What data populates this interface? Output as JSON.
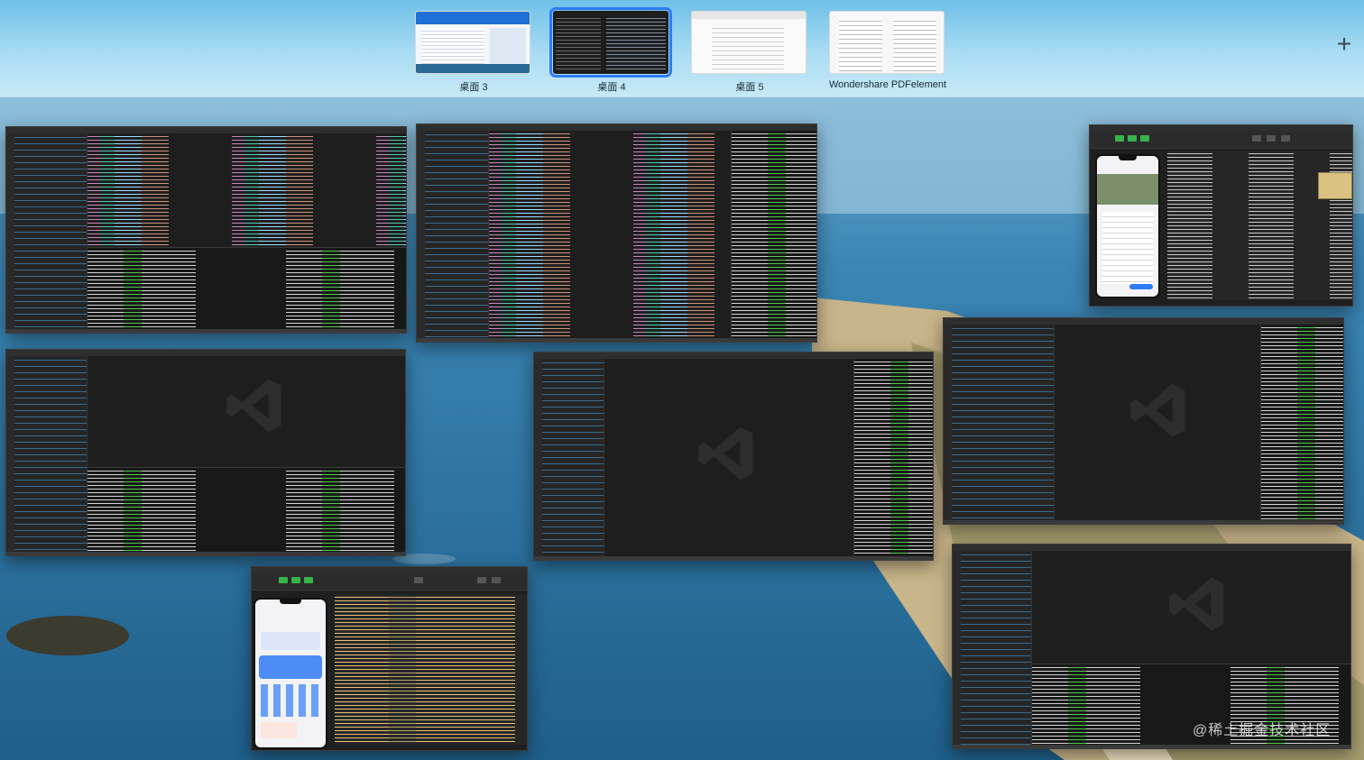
{
  "spaces_bar": {
    "spaces": [
      {
        "label": "桌面 3",
        "active": false
      },
      {
        "label": "桌面 4",
        "active": true
      },
      {
        "label": "桌面 5",
        "active": false
      },
      {
        "label": "Wondershare PDFelement",
        "active": false
      }
    ],
    "add_button": "+"
  },
  "watermark": "@稀土掘金技术社区",
  "colors": {
    "accent": "#2d7cf6",
    "vscode_bg": "#1e1e1e",
    "devtools_green": "#37b34a",
    "ocean": "#2b6a92",
    "sand": "#e6d3aa"
  },
  "icons": [
    "vscode-logo-icon",
    "plus-icon",
    "close-dot-icon",
    "minimize-dot-icon",
    "zoom-dot-icon"
  ]
}
